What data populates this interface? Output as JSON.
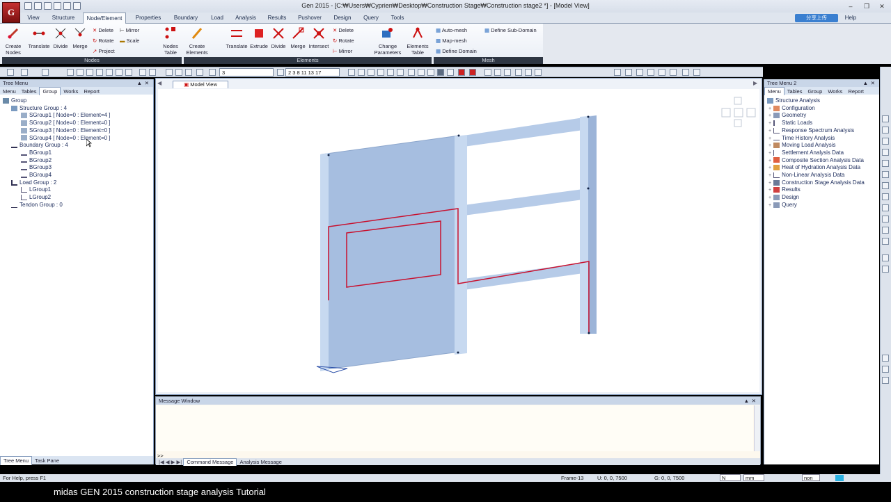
{
  "app": {
    "logo_text": "G",
    "title": "Gen 2015 - [C:₩Users₩Cyprien₩Desktop₩Construction Stage₩Construction stage2 *] - [Model View]",
    "help": "Help",
    "share": "分享上传"
  },
  "menu": [
    "View",
    "Structure",
    "Node/Element",
    "Properties",
    "Boundary",
    "Load",
    "Analysis",
    "Results",
    "Pushover",
    "Design",
    "Query",
    "Tools"
  ],
  "ribbon": {
    "create_nodes": "Create\nNodes",
    "translate": "Translate",
    "divide": "Divide",
    "merge": "Merge",
    "delete": "Delete",
    "rotate": "Rotate",
    "project": "Project",
    "mirror": "Mirror",
    "scale": "Scale",
    "nodes_table": "Nodes\nTable",
    "create_elements": "Create\nElements",
    "extrude": "Extrude",
    "intersect": "Intersect",
    "change_parameters": "Change\nParameters",
    "elements_table": "Elements\nTable",
    "auto_mesh": "Auto-mesh",
    "map_mesh": "Map-mesh",
    "define_domain": "Define Domain",
    "define_sub_domain": "Define Sub-Domain",
    "groups": [
      "Nodes",
      "Elements",
      "Mesh"
    ]
  },
  "toolbar": {
    "combo1": "3",
    "combo2": "2 3 8 11 13 17"
  },
  "left_panel": {
    "title": "Tree Menu",
    "tabs": [
      "Menu",
      "Tables",
      "Group",
      "Works",
      "Report"
    ],
    "active_tab": "Group",
    "tree": [
      {
        "label": "Group",
        "level": 0
      },
      {
        "label": "Structure Group : 4",
        "level": 1
      },
      {
        "label": "SGroup1 [ Node=0 : Element=4 ]",
        "level": 2
      },
      {
        "label": "SGroup2 [ Node=0 : Element=0 ]",
        "level": 2
      },
      {
        "label": "SGroup3 [ Node=0 : Element=0 ]",
        "level": 2
      },
      {
        "label": "SGroup4 [ Node=0 : Element=0 ]",
        "level": 2
      },
      {
        "label": "Boundary Group : 4",
        "level": 1
      },
      {
        "label": "BGroup1",
        "level": 2
      },
      {
        "label": "BGroup2",
        "level": 2
      },
      {
        "label": "BGroup3",
        "level": 2
      },
      {
        "label": "BGroup4",
        "level": 2
      },
      {
        "label": "Load Group : 2",
        "level": 1
      },
      {
        "label": "LGroup1",
        "level": 2
      },
      {
        "label": "LGroup2",
        "level": 2
      },
      {
        "label": "Tendon Group : 0",
        "level": 1
      }
    ],
    "bottom_tabs": [
      "Tree Menu",
      "Task Pane"
    ]
  },
  "model_view": {
    "tab": "Model View"
  },
  "right_panel": {
    "title": "Tree Menu 2",
    "tabs": [
      "Menu",
      "Tables",
      "Group",
      "Works",
      "Report"
    ],
    "active_tab": "Menu",
    "tree": [
      "Structure Analysis",
      "Configuration",
      "Geometry",
      "Static Loads",
      "Response Spectrum Analysis",
      "Time History Analysis",
      "Moving Load Analysis",
      "Settlement Analysis Data",
      "Composite Section Analysis Data",
      "Heat of Hydration Analysis Data",
      "Non-Linear Analysis Data",
      "Construction Stage Analysis Data",
      "Results",
      "Design",
      "Query"
    ]
  },
  "message_window": {
    "title": "Message Window",
    "prompt": ">>",
    "tabs": [
      "Command Message",
      "Analysis Message"
    ]
  },
  "status": {
    "help": "For Help, press F1",
    "frame": "Frame-13",
    "u": "U: 0, 0, 7500",
    "g": "G: 0, 0, 7500",
    "unit_force": "N",
    "unit_len": "mm",
    "none": "non"
  },
  "caption": "midas GEN 2015 construction stage analysis Tutorial"
}
